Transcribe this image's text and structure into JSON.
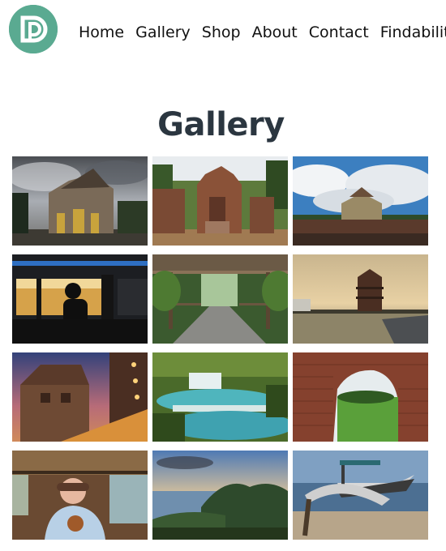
{
  "site": {
    "logo_icon": "dp-monogram-logo",
    "brand_color": "#5aaa91"
  },
  "nav": {
    "items": [
      {
        "label": "Home"
      },
      {
        "label": "Gallery"
      },
      {
        "label": "Shop"
      },
      {
        "label": "About"
      },
      {
        "label": "Contact"
      },
      {
        "label": "Findability"
      }
    ]
  },
  "page": {
    "title": "Gallery"
  },
  "gallery": {
    "photos": [
      {
        "subject": "ornate-gate-under-cloudy-sky"
      },
      {
        "subject": "brick-temple-ruins"
      },
      {
        "subject": "citadel-tower-with-clouds"
      },
      {
        "subject": "silhouette-on-train"
      },
      {
        "subject": "wooden-pergola-walkway"
      },
      {
        "subject": "pagoda-at-sunset-by-water"
      },
      {
        "subject": "wooden-stilt-house-at-dusk"
      },
      {
        "subject": "turquoise-waterfall-pools"
      },
      {
        "subject": "brick-wall-window-to-field"
      },
      {
        "subject": "child-on-boat"
      },
      {
        "subject": "coastal-hills-at-sunrise"
      },
      {
        "subject": "boat-on-beach"
      }
    ]
  }
}
